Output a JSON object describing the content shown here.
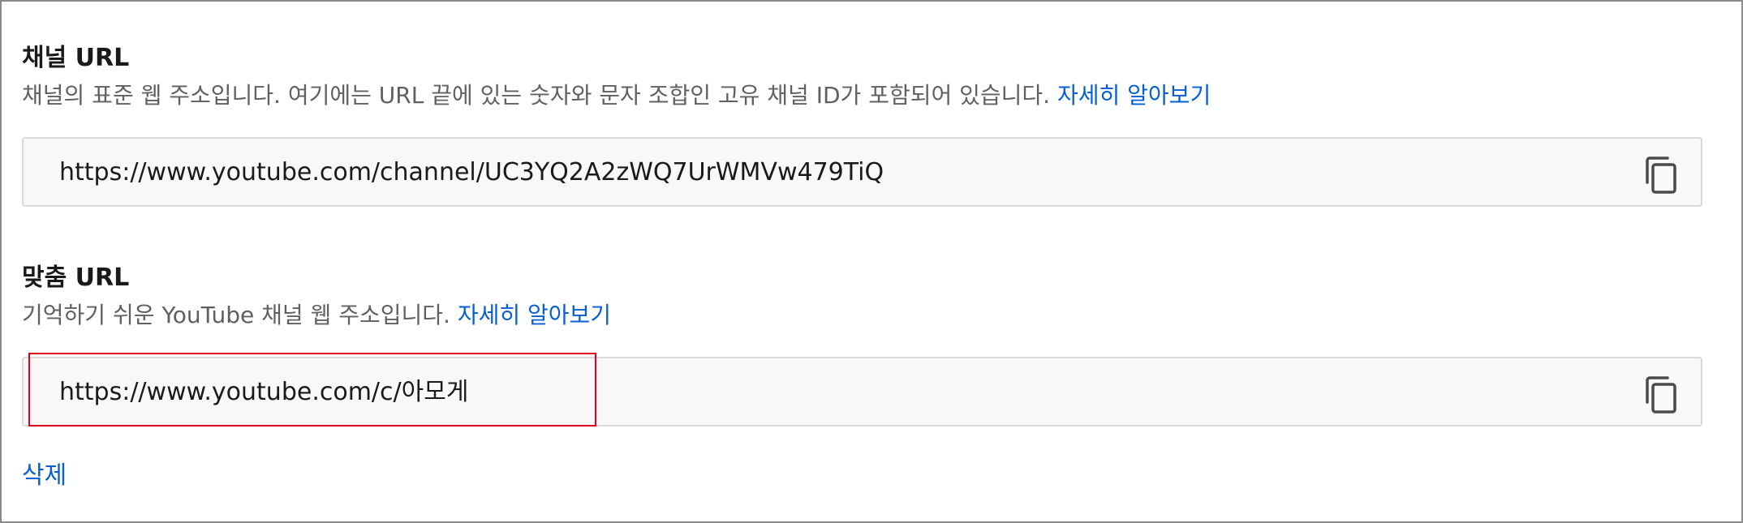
{
  "channel_url": {
    "title": "채널 URL",
    "description": "채널의 표준 웹 주소입니다. 여기에는 URL 끝에 있는 숫자와 문자 조합인 고유 채널 ID가 포함되어 있습니다.",
    "learn_more": "자세히 알아보기",
    "value": "https://www.youtube.com/channel/UC3YQ2A2zWQ7UrWMVw479TiQ",
    "copy_icon": "copy-icon"
  },
  "custom_url": {
    "title": "맞춤 URL",
    "description": "기억하기 쉬운 YouTube 채널 웹 주소입니다.",
    "learn_more": "자세히 알아보기",
    "value": "https://www.youtube.com/c/아모게",
    "copy_icon": "copy-icon",
    "delete_label": "삭제"
  },
  "colors": {
    "link": "#065fd4",
    "highlight": "#e0001b",
    "field_background": "#f8f8f8"
  }
}
